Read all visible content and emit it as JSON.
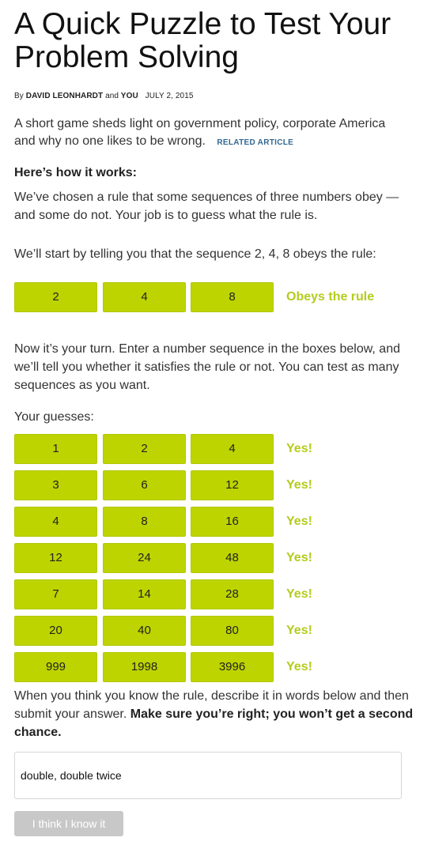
{
  "article": {
    "title": "A Quick Puzzle to Test Your Problem Solving",
    "byline_prefix": "By",
    "author": "DAVID LEONHARDT",
    "byline_and": "and",
    "coauthor": "YOU",
    "date": "JULY 2, 2015",
    "summary": "A short game sheds light on government policy, corporate America and why no one likes to be wrong.",
    "related_link": "RELATED ARTICLE"
  },
  "instructions": {
    "heading": "Here’s how it works:",
    "intro": "We’ve chosen a rule that some sequences of three numbers obey — and some do not. Your job is to guess what the rule is.",
    "start": "We’ll start by telling you that the sequence 2, 4, 8 obeys the rule:",
    "example": {
      "numbers": [
        "2",
        "4",
        "8"
      ],
      "verdict": "Obeys the rule"
    },
    "turn": "Now it’s your turn. Enter a number sequence in the boxes below, and we’ll tell you whether it satisfies the rule or not. You can test as many sequences as you want.",
    "guesses_label": "Your guesses:"
  },
  "guesses": [
    {
      "numbers": [
        "1",
        "2",
        "4"
      ],
      "verdict": "Yes!"
    },
    {
      "numbers": [
        "3",
        "6",
        "12"
      ],
      "verdict": "Yes!"
    },
    {
      "numbers": [
        "4",
        "8",
        "16"
      ],
      "verdict": "Yes!"
    },
    {
      "numbers": [
        "12",
        "24",
        "48"
      ],
      "verdict": "Yes!"
    },
    {
      "numbers": [
        "7",
        "14",
        "28"
      ],
      "verdict": "Yes!"
    },
    {
      "numbers": [
        "20",
        "40",
        "80"
      ],
      "verdict": "Yes!"
    },
    {
      "numbers": [
        "999",
        "1998",
        "3996"
      ],
      "verdict": "Yes!"
    }
  ],
  "answer": {
    "prompt_plain": "When you think you know the rule, describe it in words below and then submit your answer. ",
    "prompt_bold": "Make sure you’re right; you won’t get a second chance.",
    "value": "double, double twice",
    "submit_label": "I think I know it"
  },
  "colors": {
    "box_fill": "#bdd400",
    "verdict_text": "#b4cc1e",
    "link": "#326891",
    "submit_disabled": "#c8c8c8"
  }
}
